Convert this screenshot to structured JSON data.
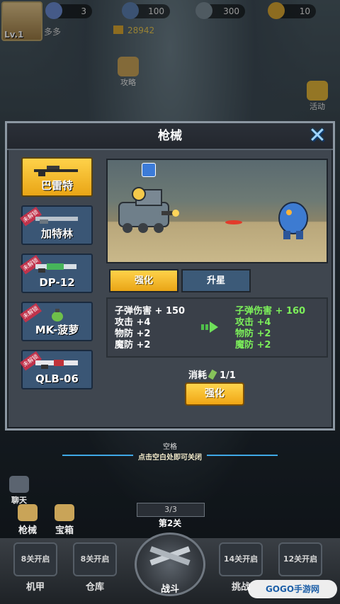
{
  "hud": {
    "level": "Lv.1",
    "player_name": "多多",
    "combat_power": "28942",
    "resources": [
      {
        "icon": "energy-icon",
        "value": "3"
      },
      {
        "icon": "battery-icon",
        "value": "100"
      },
      {
        "icon": "ammo-icon",
        "value": "300"
      },
      {
        "icon": "coin-icon",
        "value": "10"
      }
    ]
  },
  "side": {
    "strategy_label": "攻略",
    "activity_label": "活动",
    "chat_label": "聊天"
  },
  "modal": {
    "title": "枪械",
    "close_glyph": "✕",
    "guns": [
      {
        "name": "巴雷特",
        "locked": false
      },
      {
        "name": "加特林",
        "locked": true,
        "ribbon": "未解锁"
      },
      {
        "name": "DP-12",
        "locked": true,
        "ribbon": "未解锁"
      },
      {
        "name": "MK-菠萝",
        "locked": true,
        "ribbon": "未解锁"
      },
      {
        "name": "QLB-06",
        "locked": true,
        "ribbon": "未解锁"
      }
    ],
    "tabs": {
      "enhance": "强化",
      "star_up": "升星"
    },
    "stats_current": [
      "子弹伤害 + 150",
      "攻击 +4",
      "物防 +2",
      "魔防 +2"
    ],
    "stats_next": [
      "子弹伤害 + 160",
      "攻击 +4",
      "物防 +2",
      "魔防 +2"
    ],
    "cost_label": "消耗",
    "cost_value": "1/1",
    "enhance_button": "强化"
  },
  "hints": {
    "line1": "空格",
    "line2": "点击空白处即可关闭"
  },
  "bottom": {
    "left_gun": "枪械",
    "left_chest": "宝箱",
    "stage_progress": "3/3",
    "stage_name": "第2关",
    "nav": [
      {
        "box": "8关开启",
        "label": "机甲"
      },
      {
        "box": "8关开启",
        "label": "仓库"
      },
      {
        "box": "",
        "label": "战斗"
      },
      {
        "box": "14关开启",
        "label": "挑战"
      },
      {
        "box": "12关开启",
        "label": ""
      }
    ],
    "watermark": "GOGO手游网"
  },
  "colors": {
    "gold": "#f0a614",
    "blue_tile": "#3a5675",
    "green_stat": "#7cf05a",
    "panel": "#3f464f"
  }
}
